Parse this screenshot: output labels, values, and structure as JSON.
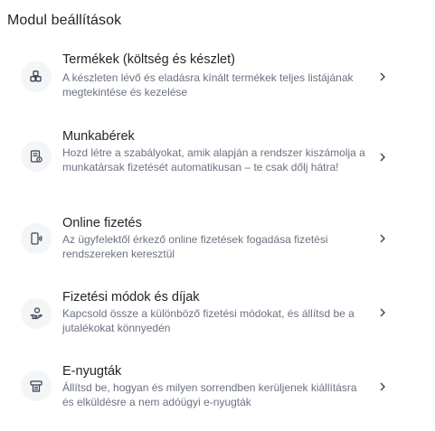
{
  "page": {
    "title": "Modul beállítások"
  },
  "items": [
    {
      "title": "Termékek (költség és készlet)",
      "description": "A készleten lévő és eladásra kínált termékek teljes listájának megtekintése és kezelése",
      "icon": "boxes-icon"
    },
    {
      "title": "Munkabérek",
      "description": "Hozd létre a szabályokat, amik alapján a rendszer kiszámolja a munkatársak fizetését automatikusan – te csak dőlj hátra!",
      "icon": "payroll-icon"
    },
    {
      "title": "Online fizetés",
      "description": "Az ügyfelektől érkező online fizetések fogadása fizetési rendszereken keresztül",
      "icon": "contactless-phone-icon"
    },
    {
      "title": "Fizetési módok és díjak",
      "description": "Kapcsold össze a különböző fizetési módokat, és állítsd be a jutalékokat könnyedén",
      "icon": "hand-coin-icon"
    },
    {
      "title": "E-nyugták",
      "description": "Állítsd be, hogyan és milyen sorrendben kerüljenek kiállításra és elküldésre a nem adóügyi e-nyugták",
      "icon": "receipt-printer-icon"
    }
  ],
  "colors": {
    "icon_bg": "#f4f5f7",
    "title_text": "#1f2328",
    "desc_text": "#6b7280"
  }
}
